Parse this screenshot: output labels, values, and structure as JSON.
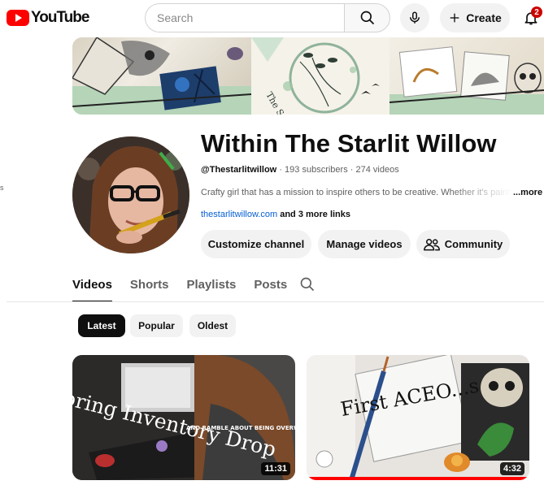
{
  "header": {
    "logo_text": "YouTube",
    "search_placeholder": "Search",
    "create_label": "Create",
    "notification_count": "2"
  },
  "sidebar": {
    "partial_text": "s"
  },
  "channel": {
    "name": "Within The Starlit Willow",
    "handle": "@Thestarlitwillow",
    "subscribers": "193 subscribers",
    "videos": "274 videos",
    "separator": "·",
    "description": "Crafty girl that has a mission to inspire others to be creative. Whether it's painting",
    "description_more": "...more",
    "link": "thestarlitwillow.com",
    "more_links": "and 3 more links"
  },
  "actions": {
    "customize": "Customize channel",
    "manage": "Manage videos",
    "community": "Community"
  },
  "tabs": [
    "Videos",
    "Shorts",
    "Playlists",
    "Posts"
  ],
  "chips": [
    "Latest",
    "Popular",
    "Oldest"
  ],
  "videos": [
    {
      "overlay_title": "Spring Inventory Drop",
      "overlay_sub": "AND RAMBLE ABOUT BEING OVERWHELMED",
      "duration": "11:31"
    },
    {
      "overlay_title": "First ACEO...s",
      "duration": "4:32"
    }
  ],
  "colors": {
    "brand_red": "#ff0000",
    "link_blue": "#065fd4",
    "chip_active": "#0f0f0f",
    "button_bg": "#f2f2f2"
  }
}
